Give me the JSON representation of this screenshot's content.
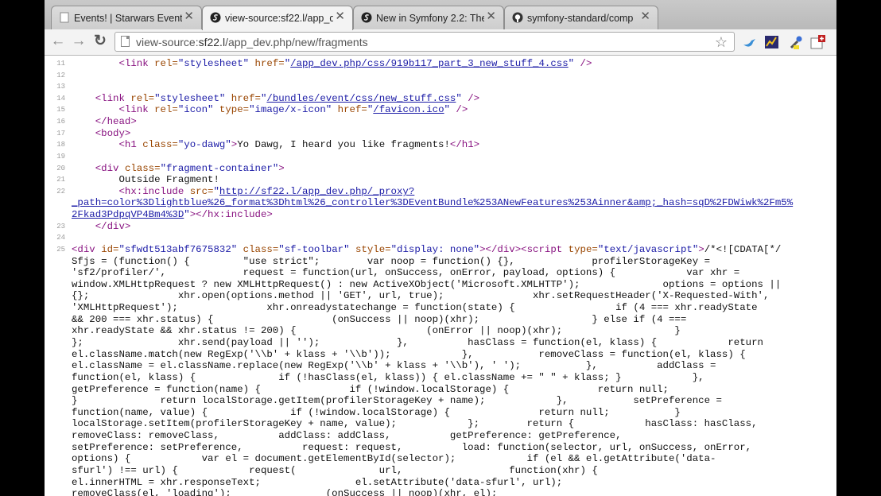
{
  "browser": {
    "tabs": [
      {
        "title": "Events! | Starwars Events",
        "active": false,
        "icon": "page-icon"
      },
      {
        "title": "view-source:sf22.l/app_d",
        "active": true,
        "icon": "symfony-icon"
      },
      {
        "title": "New in Symfony 2.2: The r",
        "active": false,
        "icon": "symfony-icon"
      },
      {
        "title": "symfony-standard/comp",
        "active": false,
        "icon": "github-icon"
      }
    ],
    "tab_close_glyph": "✕",
    "address": {
      "prefix": "view-source:",
      "host": "sf22.l",
      "path": "/app_dev.php/new/fragments"
    },
    "nav": {
      "back": "←",
      "forward": "→",
      "reload": "↻",
      "star": "☆"
    }
  },
  "source_lines": [
    {
      "num": "11",
      "segments": [
        {
          "t": "        "
        },
        {
          "c": "tag",
          "t": "<link "
        },
        {
          "c": "attr",
          "t": "rel="
        },
        {
          "c": "val",
          "t": "\"stylesheet\""
        },
        {
          "c": "attr",
          "t": " href="
        },
        {
          "c": "val",
          "t": "\""
        },
        {
          "c": "lnk",
          "t": "/app_dev.php/css/919b117_part_3_new_stuff_4.css"
        },
        {
          "c": "val",
          "t": "\""
        },
        {
          "c": "tag",
          "t": " />"
        }
      ]
    },
    {
      "num": "12",
      "segments": []
    },
    {
      "num": "13",
      "segments": []
    },
    {
      "num": "14",
      "segments": [
        {
          "t": "    "
        },
        {
          "c": "tag",
          "t": "<link "
        },
        {
          "c": "attr",
          "t": "rel="
        },
        {
          "c": "val",
          "t": "\"stylesheet\""
        },
        {
          "c": "attr",
          "t": " href="
        },
        {
          "c": "val",
          "t": "\""
        },
        {
          "c": "lnk",
          "t": "/bundles/event/css/new_stuff.css"
        },
        {
          "c": "val",
          "t": "\""
        },
        {
          "c": "tag",
          "t": " />"
        }
      ]
    },
    {
      "num": "15",
      "segments": [
        {
          "t": "        "
        },
        {
          "c": "tag",
          "t": "<link "
        },
        {
          "c": "attr",
          "t": "rel="
        },
        {
          "c": "val",
          "t": "\"icon\""
        },
        {
          "c": "attr",
          "t": " type="
        },
        {
          "c": "val",
          "t": "\"image/x-icon\""
        },
        {
          "c": "attr",
          "t": " href="
        },
        {
          "c": "val",
          "t": "\""
        },
        {
          "c": "lnk",
          "t": "/favicon.ico"
        },
        {
          "c": "val",
          "t": "\""
        },
        {
          "c": "tag",
          "t": " />"
        }
      ]
    },
    {
      "num": "16",
      "segments": [
        {
          "t": "    "
        },
        {
          "c": "tag",
          "t": "</head>"
        }
      ]
    },
    {
      "num": "17",
      "segments": [
        {
          "t": "    "
        },
        {
          "c": "tag",
          "t": "<body>"
        }
      ]
    },
    {
      "num": "18",
      "segments": [
        {
          "t": "        "
        },
        {
          "c": "tag",
          "t": "<h1 "
        },
        {
          "c": "attr",
          "t": "class="
        },
        {
          "c": "val",
          "t": "\"yo-dawg\""
        },
        {
          "c": "tag",
          "t": ">"
        },
        {
          "t": "Yo Dawg, I heard you like fragments!"
        },
        {
          "c": "tag",
          "t": "</h1>"
        }
      ]
    },
    {
      "num": "19",
      "segments": []
    },
    {
      "num": "20",
      "segments": [
        {
          "t": "    "
        },
        {
          "c": "tag",
          "t": "<div "
        },
        {
          "c": "attr",
          "t": "class="
        },
        {
          "c": "val",
          "t": "\"fragment-container\""
        },
        {
          "c": "tag",
          "t": ">"
        }
      ]
    },
    {
      "num": "21",
      "segments": [
        {
          "t": "        Outside Fragment!"
        }
      ]
    },
    {
      "num": "22",
      "segments": [
        {
          "t": "        "
        },
        {
          "c": "tag",
          "t": "<hx:include "
        },
        {
          "c": "attr",
          "t": "src="
        },
        {
          "c": "val",
          "t": "\""
        },
        {
          "c": "lnk",
          "t": "http://sf22.l/app_dev.php/_proxy?"
        }
      ]
    },
    {
      "num": "",
      "segments": [
        {
          "c": "lnk",
          "t": "_path=color%3Dlightblue%26_format%3Dhtml%26_controller%3DEventBundle%253ANewFeatures%253Ainner&amp;_hash=sqD%2FDWiwk%2Fm5%"
        }
      ]
    },
    {
      "num": "",
      "segments": [
        {
          "c": "lnk",
          "t": "2Fkad3PdpqVP4Bm4%3D"
        },
        {
          "c": "val",
          "t": "\""
        },
        {
          "c": "tag",
          "t": "></hx:include>"
        }
      ]
    },
    {
      "num": "23",
      "segments": [
        {
          "t": "    "
        },
        {
          "c": "tag",
          "t": "</div>"
        }
      ]
    },
    {
      "num": "24",
      "segments": []
    },
    {
      "num": "25",
      "segments": [
        {
          "c": "tag",
          "t": "<div "
        },
        {
          "c": "attr",
          "t": "id="
        },
        {
          "c": "val",
          "t": "\"sfwdt513abf7675832\""
        },
        {
          "c": "attr",
          "t": " class="
        },
        {
          "c": "val",
          "t": "\"sf-toolbar\""
        },
        {
          "c": "attr",
          "t": " style="
        },
        {
          "c": "val",
          "t": "\"display: none\""
        },
        {
          "c": "tag",
          "t": "></div><script "
        },
        {
          "c": "attr",
          "t": "type="
        },
        {
          "c": "val",
          "t": "\"text/javascript\""
        },
        {
          "c": "tag",
          "t": ">"
        },
        {
          "t": "/*<![CDATA[*/"
        }
      ]
    },
    {
      "num": "",
      "segments": [
        {
          "t": "Sfjs = (function() {         \"use strict\";        var noop = function() {},             profilerStorageKey ="
        }
      ]
    },
    {
      "num": "",
      "segments": [
        {
          "t": "'sf2/profiler/',             request = function(url, onSuccess, onError, payload, options) {            var xhr ="
        }
      ]
    },
    {
      "num": "",
      "segments": [
        {
          "t": "window.XMLHttpRequest ? new XMLHttpRequest() : new ActiveXObject('Microsoft.XMLHTTP');              options = options ||"
        }
      ]
    },
    {
      "num": "",
      "segments": [
        {
          "t": "{};               xhr.open(options.method || 'GET', url, true);               xhr.setRequestHeader('X-Requested-With',"
        }
      ]
    },
    {
      "num": "",
      "segments": [
        {
          "t": "'XMLHttpRequest');               xhr.onreadystatechange = function(state) {                 if (4 === xhr.readyState"
        }
      ]
    },
    {
      "num": "",
      "segments": [
        {
          "t": "&& 200 === xhr.status) {                    (onSuccess || noop)(xhr);                   } else if (4 ==="
        }
      ]
    },
    {
      "num": "",
      "segments": [
        {
          "t": "xhr.readyState && xhr.status != 200) {                      (onError || noop)(xhr);                   }"
        }
      ]
    },
    {
      "num": "",
      "segments": [
        {
          "t": "};                xhr.send(payload || '');             },          hasClass = function(el, klass) {            return"
        }
      ]
    },
    {
      "num": "",
      "segments": [
        {
          "t": "el.className.match(new RegExp('\\\\b' + klass + '\\\\b'));            },           removeClass = function(el, klass) {"
        }
      ]
    },
    {
      "num": "",
      "segments": [
        {
          "t": "el.className = el.className.replace(new RegExp('\\\\b' + klass + '\\\\b'), ' ');           },          addClass ="
        }
      ]
    },
    {
      "num": "",
      "segments": [
        {
          "t": "function(el, klass) {              if (!hasClass(el, klass)) { el.className += \" \" + klass; }            },"
        }
      ]
    },
    {
      "num": "",
      "segments": [
        {
          "t": "getPreference = function(name) {               if (!window.localStorage) {               return null;"
        }
      ]
    },
    {
      "num": "",
      "segments": [
        {
          "t": "}              return localStorage.getItem(profilerStorageKey + name);            },           setPreference ="
        }
      ]
    },
    {
      "num": "",
      "segments": [
        {
          "t": "function(name, value) {              if (!window.localStorage) {               return null;           }"
        }
      ]
    },
    {
      "num": "",
      "segments": [
        {
          "t": "localStorage.setItem(profilerStorageKey + name, value);            };        return {            hasClass: hasClass,"
        }
      ]
    },
    {
      "num": "",
      "segments": [
        {
          "t": "removeClass: removeClass,          addClass: addClass,          getPreference: getPreference,"
        }
      ]
    },
    {
      "num": "",
      "segments": [
        {
          "t": "setPreference: setPreference,          request: request,          load: function(selector, url, onSuccess, onError,"
        }
      ]
    },
    {
      "num": "",
      "segments": [
        {
          "t": "options) {            var el = document.getElementById(selector);            if (el && el.getAttribute('data-"
        }
      ]
    },
    {
      "num": "",
      "segments": [
        {
          "t": "sfurl') !== url) {            request(              url,                  function(xhr) {"
        }
      ]
    },
    {
      "num": "",
      "segments": [
        {
          "t": "el.innerHTML = xhr.responseText;                el.setAttribute('data-sfurl', url);"
        }
      ]
    },
    {
      "num": "",
      "segments": [
        {
          "t": "removeClass(el, 'loading');                (onSuccess || noop)(xhr, el);"
        }
      ]
    }
  ]
}
